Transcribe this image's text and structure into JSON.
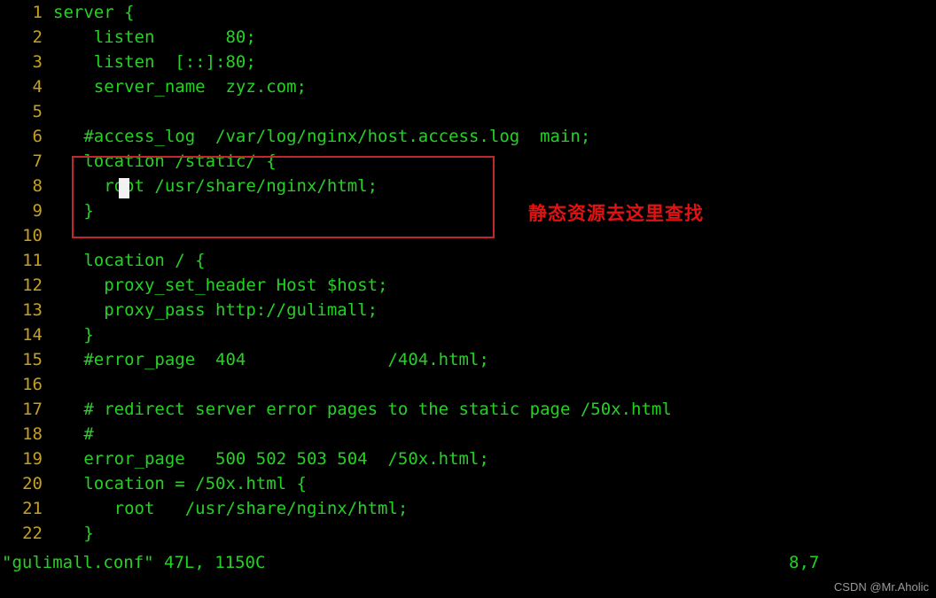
{
  "editor": {
    "kind": "vim-terminal-editor",
    "filename": "gulimall.conf",
    "colors": {
      "background": "#000000",
      "code_text": "#25d125",
      "line_number": "#c8a020",
      "cursor_block": "#f2f2f2",
      "annotation_red": "#e21212",
      "highlight_box_red": "#c1272d",
      "watermark_gray": "#9a9a9a"
    },
    "lines": [
      {
        "no": "1",
        "code": "server {"
      },
      {
        "no": "2",
        "code": "    listen       80;"
      },
      {
        "no": "3",
        "code": "    listen  [::]:80;"
      },
      {
        "no": "4",
        "code": "    server_name  zyz.com;"
      },
      {
        "no": "5",
        "code": ""
      },
      {
        "no": "6",
        "code": "   #access_log  /var/log/nginx/host.access.log  main;"
      },
      {
        "no": "7",
        "code": "   location /static/ {"
      },
      {
        "no": "8",
        "code": "     root /usr/share/nginx/html;"
      },
      {
        "no": "9",
        "code": "   }"
      },
      {
        "no": "10",
        "code": ""
      },
      {
        "no": "11",
        "code": "   location / {"
      },
      {
        "no": "12",
        "code": "     proxy_set_header Host $host;"
      },
      {
        "no": "13",
        "code": "     proxy_pass http://gulimall;"
      },
      {
        "no": "14",
        "code": "   }"
      },
      {
        "no": "15",
        "code": "   #error_page  404              /404.html;"
      },
      {
        "no": "16",
        "code": ""
      },
      {
        "no": "17",
        "code": "   # redirect server error pages to the static page /50x.html"
      },
      {
        "no": "18",
        "code": "   #"
      },
      {
        "no": "19",
        "code": "   error_page   500 502 503 504  /50x.html;"
      },
      {
        "no": "20",
        "code": "   location = /50x.html {"
      },
      {
        "no": "21",
        "code": "      root   /usr/share/nginx/html;"
      },
      {
        "no": "22",
        "code": "   }"
      }
    ]
  },
  "cursor": {
    "label": "block-cursor",
    "on_line": "8",
    "before_text": "root"
  },
  "annotation": {
    "text": "静态资源去这里查找"
  },
  "statusbar": {
    "file_info": "\"gulimall.conf\" 47L, 1150C",
    "cursor_position": "8,7"
  },
  "watermark": {
    "text": "CSDN @Mr.Aholic"
  }
}
